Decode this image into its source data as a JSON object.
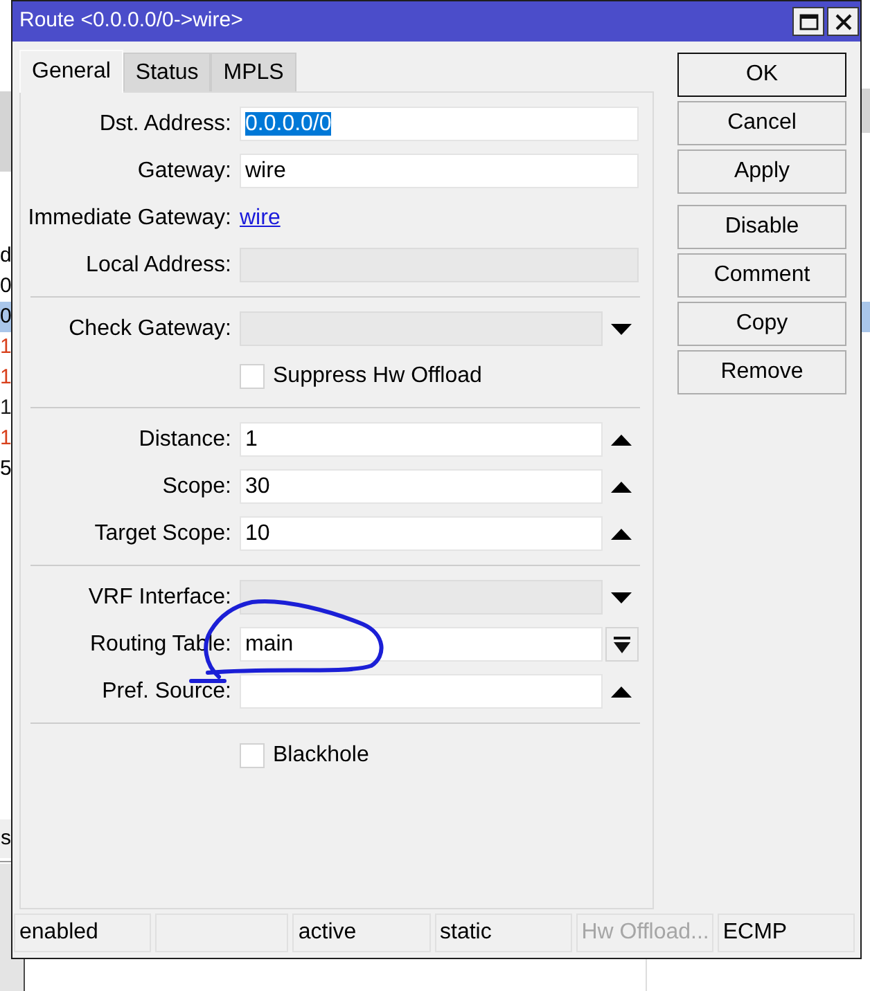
{
  "window": {
    "title": "Route <0.0.0.0/0->wire>"
  },
  "tabs": [
    {
      "label": "General",
      "selected": true
    },
    {
      "label": "Status",
      "selected": false
    },
    {
      "label": "MPLS",
      "selected": false
    }
  ],
  "form": {
    "sections": [
      {
        "rows": [
          {
            "kind": "field",
            "label": "Dst. Address:",
            "value": "0.0.0.0/0",
            "text_selected": true,
            "disabled": false
          },
          {
            "kind": "field",
            "label": "Gateway:",
            "value": "wire",
            "text_selected": false,
            "disabled": false
          },
          {
            "kind": "link",
            "label": "Immediate Gateway:",
            "value": "wire"
          },
          {
            "kind": "field",
            "label": "Local Address:",
            "disabled": true
          }
        ]
      },
      {
        "rows": [
          {
            "kind": "field",
            "label": "Check Gateway:",
            "disabled": true,
            "control": {
              "kind": "dropdown"
            }
          },
          {
            "kind": "checkbox",
            "label": "Suppress Hw Offload",
            "checked": false
          }
        ]
      },
      {
        "rows": [
          {
            "kind": "field",
            "label": "Distance:",
            "value": "1",
            "text_selected": false,
            "disabled": false,
            "control": {
              "kind": "collapse"
            }
          },
          {
            "kind": "field",
            "label": "Scope:",
            "value": "30",
            "text_selected": false,
            "disabled": false,
            "control": {
              "kind": "collapse"
            }
          },
          {
            "kind": "field",
            "label": "Target Scope:",
            "value": "10",
            "text_selected": false,
            "disabled": false,
            "control": {
              "kind": "collapse"
            }
          }
        ]
      },
      {
        "rows": [
          {
            "kind": "field",
            "label": "VRF Interface:",
            "disabled": true,
            "control": {
              "kind": "dropdown"
            }
          },
          {
            "kind": "field",
            "label": "Routing Table:",
            "value": "main",
            "text_selected": false,
            "disabled": false,
            "control": {
              "kind": "picker"
            }
          },
          {
            "kind": "field",
            "label": "Pref. Source:",
            "disabled": false,
            "control": {
              "kind": "collapse"
            }
          }
        ]
      },
      {
        "rows": [
          {
            "kind": "checkbox",
            "label": "Blackhole",
            "checked": false
          }
        ]
      }
    ]
  },
  "button_groups": [
    [
      {
        "label": "OK",
        "default": true
      },
      {
        "label": "Cancel",
        "default": false
      },
      {
        "label": "Apply",
        "default": false
      }
    ],
    [
      {
        "label": "Disable",
        "default": false
      },
      {
        "label": "Comment",
        "default": false
      },
      {
        "label": "Copy",
        "default": false
      },
      {
        "label": "Remove",
        "default": false
      }
    ]
  ],
  "status_bar": [
    {
      "kind": "text",
      "text": "enabled",
      "disabled": false
    },
    {
      "kind": "empty"
    },
    {
      "kind": "text",
      "text": "active",
      "disabled": false
    },
    {
      "kind": "text",
      "text": "static",
      "disabled": false
    },
    {
      "kind": "text",
      "text": "Hw Offload...",
      "disabled": true
    },
    {
      "kind": "text",
      "text": "ECMP",
      "disabled": false
    }
  ],
  "background_window": {
    "header": "d",
    "rows": [
      {
        "text": "0",
        "selected": false,
        "color": "#000000"
      },
      {
        "text": "0",
        "selected": true,
        "color": "#000000"
      },
      {
        "text": "1",
        "selected": false,
        "color": "#d8401c"
      },
      {
        "text": "1",
        "selected": false,
        "color": "#d8401c"
      },
      {
        "text": "1",
        "selected": false,
        "color": "#1e1e1e"
      },
      {
        "text": "1",
        "selected": false,
        "color": "#d8401c"
      },
      {
        "text": "5",
        "selected": false,
        "color": "#000000"
      }
    ],
    "footer": "s"
  }
}
